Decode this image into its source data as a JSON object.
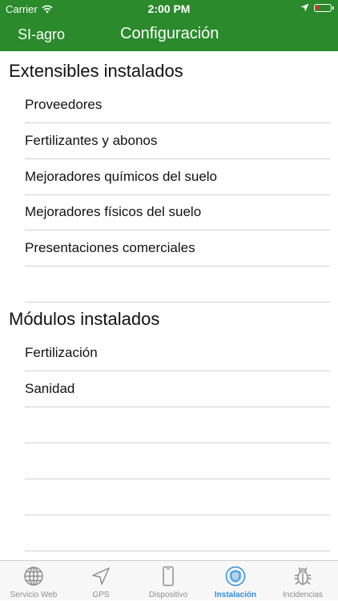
{
  "status_bar": {
    "carrier": "Carrier",
    "time": "2:00 PM"
  },
  "nav": {
    "back_label": "SI-agro",
    "title": "Configuración"
  },
  "sections": [
    {
      "header": "Extensibles instalados",
      "items": [
        "Proveedores",
        "Fertilizantes y abonos",
        "Mejoradores químicos del suelo",
        "Mejoradores físicos del suelo",
        "Presentaciones comerciales",
        ""
      ]
    },
    {
      "header": "Módulos instalados",
      "items": [
        "Fertilización",
        "Sanidad",
        "",
        "",
        "",
        ""
      ]
    }
  ],
  "tabs": [
    {
      "label": "Servicio Web",
      "icon": "globe-icon"
    },
    {
      "label": "GPS",
      "icon": "location-arrow-icon"
    },
    {
      "label": "Dispositivo",
      "icon": "phone-icon"
    },
    {
      "label": "Instalación",
      "icon": "shield-icon",
      "active": true
    },
    {
      "label": "Incidencias",
      "icon": "bug-icon"
    }
  ],
  "colors": {
    "brand_green": "#2a8a2c",
    "tab_active": "#2f8fd8",
    "tab_inactive": "#8e8e8e",
    "battery_low": "#e53030"
  }
}
